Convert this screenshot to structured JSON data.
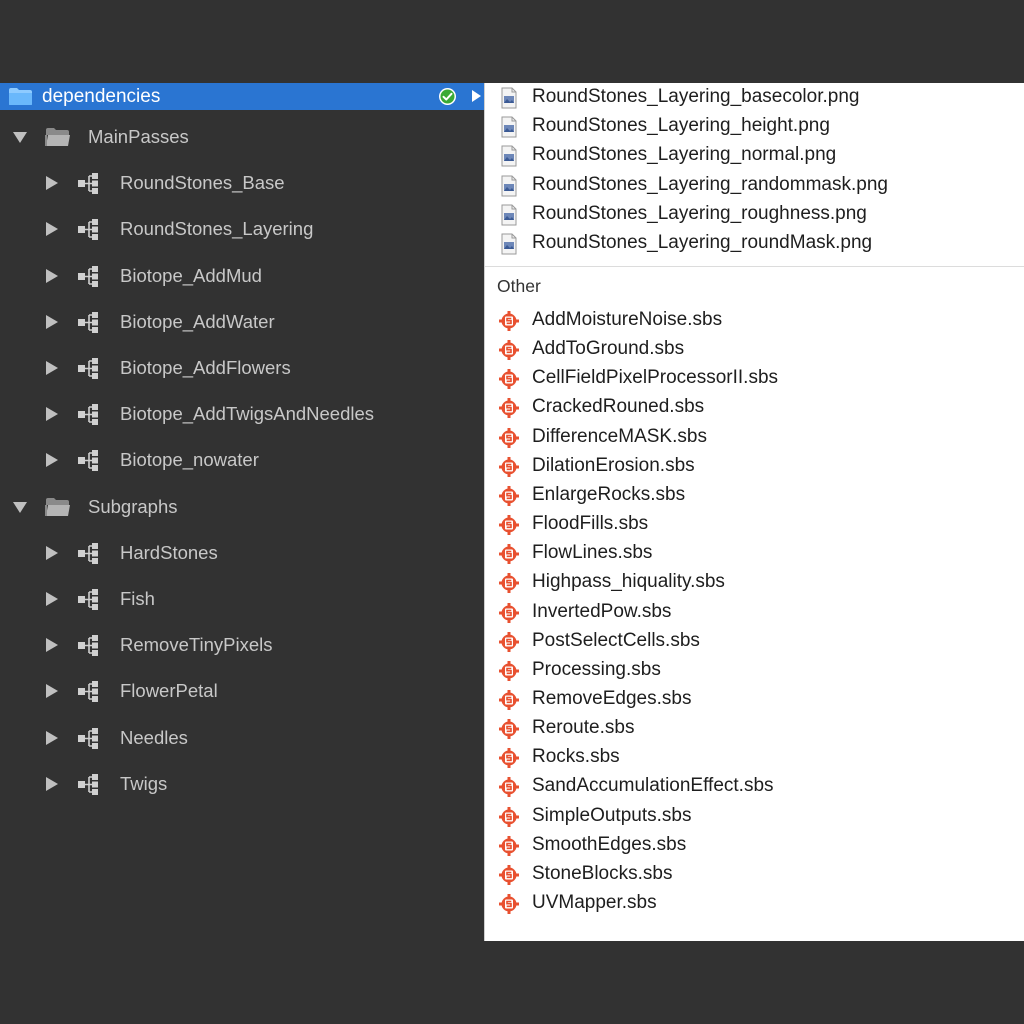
{
  "selected": {
    "label": "dependencies",
    "status_icon": "check-circle-icon"
  },
  "tree": [
    {
      "kind": "folder",
      "label": "MainPasses",
      "expanded": true
    },
    {
      "kind": "graph",
      "label": "RoundStones_Base"
    },
    {
      "kind": "graph",
      "label": "RoundStones_Layering"
    },
    {
      "kind": "graph",
      "label": "Biotope_AddMud"
    },
    {
      "kind": "graph",
      "label": "Biotope_AddWater"
    },
    {
      "kind": "graph",
      "label": "Biotope_AddFlowers"
    },
    {
      "kind": "graph",
      "label": "Biotope_AddTwigsAndNeedles"
    },
    {
      "kind": "graph",
      "label": "Biotope_nowater"
    },
    {
      "kind": "folder",
      "label": "Subgraphs",
      "expanded": true
    },
    {
      "kind": "graph",
      "label": "HardStones"
    },
    {
      "kind": "graph",
      "label": "Fish"
    },
    {
      "kind": "graph",
      "label": "RemoveTinyPixels"
    },
    {
      "kind": "graph",
      "label": "FlowerPetal"
    },
    {
      "kind": "graph",
      "label": "Needles"
    },
    {
      "kind": "graph",
      "label": "Twigs"
    }
  ],
  "popup": {
    "images": [
      "RoundStones_Layering_basecolor.png",
      "RoundStones_Layering_height.png",
      "RoundStones_Layering_normal.png",
      "RoundStones_Layering_randommask.png",
      "RoundStones_Layering_roughness.png",
      "RoundStones_Layering_roundMask.png"
    ],
    "section_label": "Other",
    "sbs_files": [
      "AddMoistureNoise.sbs",
      "AddToGround.sbs",
      "CellFieldPixelProcessorII.sbs",
      "CrackedRouned.sbs",
      "DifferenceMASK.sbs",
      "DilationErosion.sbs",
      "EnlargeRocks.sbs",
      "FloodFills.sbs",
      "FlowLines.sbs",
      "Highpass_hiquality.sbs",
      "InvertedPow.sbs",
      "PostSelectCells.sbs",
      "Processing.sbs",
      "RemoveEdges.sbs",
      "Reroute.sbs",
      "Rocks.sbs",
      "SandAccumulationEffect.sbs",
      "SimpleOutputs.sbs",
      "SmoothEdges.sbs",
      "StoneBlocks.sbs",
      "UVMapper.sbs"
    ]
  },
  "colors": {
    "background": "#323232",
    "selection": "#2a75d2",
    "tree_text": "#c8c8c8",
    "sbs_icon": "#e8502f",
    "check": "#3aa935"
  }
}
